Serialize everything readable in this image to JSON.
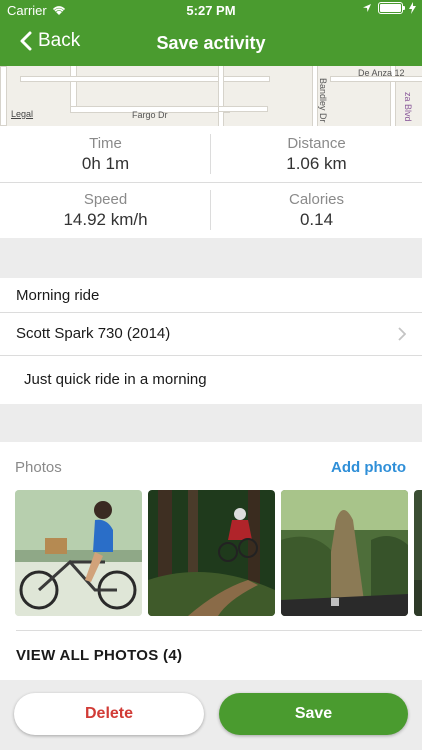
{
  "status_bar": {
    "carrier": "Carrier",
    "time": "5:27 PM"
  },
  "nav": {
    "back_label": "Back",
    "title": "Save activity"
  },
  "map": {
    "labels": [
      "De Anza 12",
      "Bandley Dr",
      "Fargo Dr",
      "za Blvd",
      "Legal"
    ]
  },
  "stats": {
    "time": {
      "label": "Time",
      "value": "0h 1m"
    },
    "distance": {
      "label": "Distance",
      "value": "1.06 km"
    },
    "speed": {
      "label": "Speed",
      "value": "14.92 km/h"
    },
    "calories": {
      "label": "Calories",
      "value": "0.14"
    }
  },
  "form": {
    "name": "Morning ride",
    "bike": "Scott Spark 730 (2014)",
    "description": "Just quick ride in a morning"
  },
  "photos": {
    "header": "Photos",
    "add_label": "Add photo",
    "view_all": "VIEW ALL PHOTOS (4)"
  },
  "actions": {
    "delete": "Delete",
    "save": "Save"
  },
  "colors": {
    "primary": "#4a9b2f",
    "link": "#2f8fd8",
    "danger": "#d13b36"
  }
}
